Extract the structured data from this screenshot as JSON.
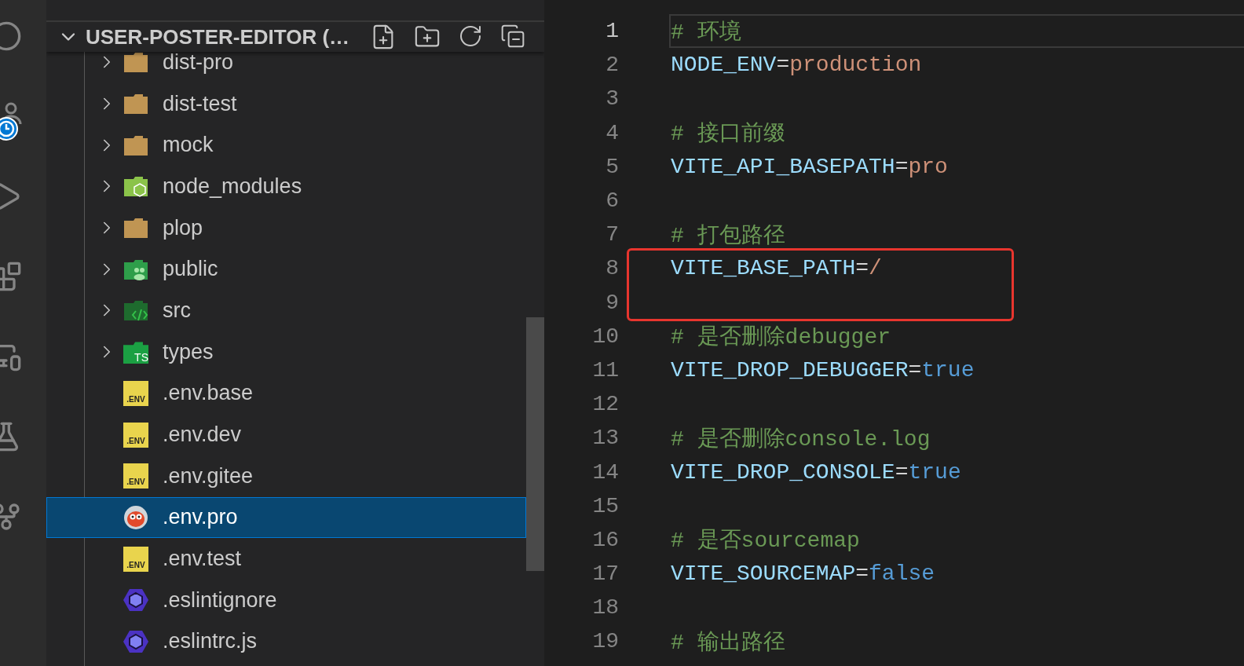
{
  "explorer": {
    "title": "USER-POSTER-EDITOR (…",
    "expanded": true
  },
  "tree": [
    {
      "name": "dist-pro",
      "kind": "folder",
      "selected": false
    },
    {
      "name": "dist-test",
      "kind": "folder",
      "selected": false
    },
    {
      "name": "mock",
      "kind": "folder",
      "selected": false
    },
    {
      "name": "node_modules",
      "kind": "nodefolder",
      "selected": false
    },
    {
      "name": "plop",
      "kind": "folder",
      "selected": false
    },
    {
      "name": "public",
      "kind": "peoplefolder",
      "selected": false
    },
    {
      "name": "src",
      "kind": "codefolder",
      "selected": false
    },
    {
      "name": "types",
      "kind": "tsfolder",
      "badge": "TS",
      "selected": false
    },
    {
      "name": ".env.base",
      "kind": "envfile",
      "badge": ".ENV",
      "selected": false
    },
    {
      "name": ".env.dev",
      "kind": "envfile",
      "badge": ".ENV",
      "selected": false
    },
    {
      "name": ".env.gitee",
      "kind": "envfile",
      "badge": ".ENV",
      "selected": false
    },
    {
      "name": ".env.pro",
      "kind": "owlfile",
      "selected": true
    },
    {
      "name": ".env.test",
      "kind": "envfile",
      "badge": ".ENV",
      "selected": false
    },
    {
      "name": ".eslintignore",
      "kind": "eslintfile",
      "selected": false
    },
    {
      "name": ".eslintrc.js",
      "kind": "eslintfile",
      "selected": false
    }
  ],
  "lines": [
    {
      "number": "1",
      "current": true,
      "annotated": false,
      "tokens": [
        {
          "kind": "comment",
          "text": "# 环境"
        }
      ]
    },
    {
      "number": "2",
      "current": false,
      "annotated": false,
      "tokens": [
        {
          "kind": "key",
          "text": "NODE_ENV"
        },
        {
          "kind": "op",
          "text": "="
        },
        {
          "kind": "string",
          "text": "production"
        }
      ]
    },
    {
      "number": "3",
      "current": false,
      "annotated": false
    },
    {
      "number": "4",
      "current": false,
      "annotated": false,
      "tokens": [
        {
          "kind": "comment",
          "text": "# 接口前缀"
        }
      ]
    },
    {
      "number": "5",
      "current": false,
      "annotated": false,
      "tokens": [
        {
          "kind": "key",
          "text": "VITE_API_BASEPATH"
        },
        {
          "kind": "op",
          "text": "="
        },
        {
          "kind": "string",
          "text": "pro"
        }
      ]
    },
    {
      "number": "6",
      "current": false,
      "annotated": false
    },
    {
      "number": "7",
      "current": false,
      "annotated": false,
      "tokens": [
        {
          "kind": "comment",
          "text": "# 打包路径"
        }
      ]
    },
    {
      "number": "8",
      "current": false,
      "annotated": true,
      "tokens": [
        {
          "kind": "key",
          "text": "VITE_BASE_PATH"
        },
        {
          "kind": "op",
          "text": "="
        },
        {
          "kind": "string",
          "text": "/"
        }
      ]
    },
    {
      "number": "9",
      "current": false,
      "annotated": true
    },
    {
      "number": "10",
      "current": false,
      "annotated": false,
      "tokens": [
        {
          "kind": "comment",
          "text": "# 是否删除debugger"
        }
      ]
    },
    {
      "number": "11",
      "current": false,
      "annotated": false,
      "tokens": [
        {
          "kind": "key",
          "text": "VITE_DROP_DEBUGGER"
        },
        {
          "kind": "op",
          "text": "="
        },
        {
          "kind": "keyword",
          "text": "true"
        }
      ]
    },
    {
      "number": "12",
      "current": false,
      "annotated": false
    },
    {
      "number": "13",
      "current": false,
      "annotated": false,
      "tokens": [
        {
          "kind": "comment",
          "text": "# 是否删除console.log"
        }
      ]
    },
    {
      "number": "14",
      "current": false,
      "annotated": false,
      "tokens": [
        {
          "kind": "key",
          "text": "VITE_DROP_CONSOLE"
        },
        {
          "kind": "op",
          "text": "="
        },
        {
          "kind": "keyword",
          "text": "true"
        }
      ]
    },
    {
      "number": "15",
      "current": false,
      "annotated": false
    },
    {
      "number": "16",
      "current": false,
      "annotated": false,
      "tokens": [
        {
          "kind": "comment",
          "text": "# 是否sourcemap"
        }
      ]
    },
    {
      "number": "17",
      "current": false,
      "annotated": false,
      "tokens": [
        {
          "kind": "key",
          "text": "VITE_SOURCEMAP"
        },
        {
          "kind": "op",
          "text": "="
        },
        {
          "kind": "keyword",
          "text": "false"
        }
      ]
    },
    {
      "number": "18",
      "current": false,
      "annotated": false
    },
    {
      "number": "19",
      "current": false,
      "annotated": false,
      "tokens": [
        {
          "kind": "comment",
          "text": "# 输出路径"
        }
      ]
    }
  ]
}
